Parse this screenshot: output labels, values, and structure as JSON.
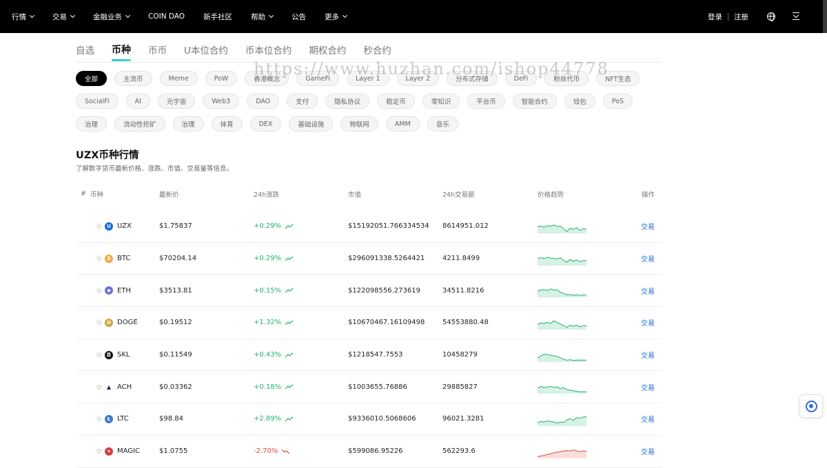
{
  "nav": {
    "items": [
      {
        "label": "行情",
        "dropdown": true
      },
      {
        "label": "交易",
        "dropdown": true
      },
      {
        "label": "金融业务",
        "dropdown": true
      },
      {
        "label": "COIN DAO",
        "dropdown": false
      },
      {
        "label": "新手社区",
        "dropdown": false
      },
      {
        "label": "帮助",
        "dropdown": true
      },
      {
        "label": "公告",
        "dropdown": false
      },
      {
        "label": "更多",
        "dropdown": true
      }
    ],
    "login": "登录",
    "register": "注册",
    "language_icon": "globe-icon",
    "download_icon": "download-icon"
  },
  "tabs": [
    "自选",
    "币种",
    "币币",
    "U本位合约",
    "币本位合约",
    "期权合约",
    "秒合约"
  ],
  "active_tab": 1,
  "chips": [
    [
      "全部",
      "主流币",
      "Meme",
      "PoW",
      "香港概念",
      "GameFi",
      "Layer 1",
      "Layer 2",
      "分布式存储",
      "DeFi",
      "粉丝代币",
      "NFT生态"
    ],
    [
      "SocialFi",
      "AI",
      "元宇宙",
      "Web3",
      "DAO",
      "支付",
      "隐私协议",
      "稳定币",
      "零知识",
      "平台币",
      "智能合约",
      "钱包",
      "PoS"
    ],
    [
      "治理",
      "流动性挖矿",
      "治理",
      "体育",
      "DEX",
      "基础设施",
      "物联网",
      "AMM",
      "音乐"
    ]
  ],
  "watermark": "https://www.huzhan.com/ishop44778",
  "section": {
    "title": "UZX币种行情",
    "subtitle": "了解数字货币最新价格、涨跌、市值、交易量等信息。"
  },
  "table": {
    "headers": {
      "hash": "#",
      "name": "币种",
      "price": "最新价",
      "change": "24h涨跌",
      "cap": "市值",
      "vol": "24h交易额",
      "trend": "价格趋势",
      "op": "操作"
    },
    "rows": [
      {
        "symbol": "UZX",
        "price": "$1.75837",
        "change": "+0.29%",
        "dir": "up",
        "cap": "$15192051.766334534",
        "vol": "8614951.012",
        "icon_color": "#1b6fd6",
        "icon_glyph": "U",
        "spark": [
          0.55,
          0.6,
          0.5,
          0.62,
          0.58,
          0.7,
          0.55,
          0.6,
          0.35,
          0.1,
          0.4,
          0.3,
          0.45,
          0.2,
          0.35,
          0.3
        ],
        "op": "交易"
      },
      {
        "symbol": "BTC",
        "price": "$70204.14",
        "change": "+0.29%",
        "dir": "up",
        "cap": "$296091338.5264421",
        "vol": "4211.8499",
        "icon_color": "#f2a43a",
        "icon_glyph": "₿",
        "spark": [
          0.6,
          0.65,
          0.58,
          0.7,
          0.62,
          0.6,
          0.55,
          0.66,
          0.4,
          0.25,
          0.5,
          0.35,
          0.45,
          0.3,
          0.4,
          0.38
        ],
        "op": "交易"
      },
      {
        "symbol": "ETH",
        "price": "$3513.81",
        "change": "+0.15%",
        "dir": "up",
        "cap": "$122098556.273619",
        "vol": "34511.8216",
        "icon_color": "#6773d9",
        "icon_glyph": "◆",
        "spark": [
          0.5,
          0.6,
          0.65,
          0.55,
          0.7,
          0.6,
          0.62,
          0.4,
          0.3,
          0.15,
          0.2,
          0.1,
          0.18,
          0.12,
          0.15,
          0.14
        ],
        "op": "交易"
      },
      {
        "symbol": "DOGE",
        "price": "$0.19512",
        "change": "+1.32%",
        "dir": "up",
        "cap": "$10670467.16109498",
        "vol": "54553880.48",
        "icon_color": "#c9a63a",
        "icon_glyph": "D",
        "spark": [
          0.4,
          0.55,
          0.5,
          0.6,
          0.5,
          0.75,
          0.6,
          0.45,
          0.3,
          0.15,
          0.35,
          0.25,
          0.35,
          0.2,
          0.3,
          0.28
        ],
        "op": "交易"
      },
      {
        "symbol": "SKL",
        "price": "$0.11549",
        "change": "+0.43%",
        "dir": "up",
        "cap": "$1218547.7553",
        "vol": "10458279",
        "icon_color": "#111111",
        "icon_glyph": "◘",
        "spark": [
          0.3,
          0.5,
          0.65,
          0.6,
          0.55,
          0.5,
          0.45,
          0.3,
          0.2,
          0.1,
          0.15,
          0.08,
          0.12,
          0.1,
          0.12,
          0.1
        ],
        "op": "交易"
      },
      {
        "symbol": "ACH",
        "price": "$0.03362",
        "change": "+0.18%",
        "dir": "up",
        "cap": "$1003655.76886",
        "vol": "29885827",
        "icon_color": "#ffffff",
        "icon_glyph": "▲",
        "spark": [
          0.45,
          0.6,
          0.5,
          0.55,
          0.6,
          0.5,
          0.55,
          0.4,
          0.5,
          0.3,
          0.25,
          0.2,
          0.15,
          0.1,
          0.12,
          0.1
        ],
        "op": "交易"
      },
      {
        "symbol": "LTC",
        "price": "$98.84",
        "change": "+2.89%",
        "dir": "up",
        "cap": "$9336010.5068606",
        "vol": "96021.3281",
        "icon_color": "#3d79d8",
        "icon_glyph": "Ł",
        "spark": [
          0.25,
          0.35,
          0.3,
          0.4,
          0.35,
          0.3,
          0.2,
          0.3,
          0.25,
          0.5,
          0.6,
          0.45,
          0.7,
          0.65,
          0.75,
          0.8
        ],
        "op": "交易"
      },
      {
        "symbol": "MAGIC",
        "price": "$1.0755",
        "change": "-2.70%",
        "dir": "down",
        "cap": "$599086.95226",
        "vol": "562293.6",
        "icon_color": "#d64040",
        "icon_glyph": "✦",
        "spark": [
          0.1,
          0.15,
          0.2,
          0.3,
          0.35,
          0.45,
          0.5,
          0.55,
          0.6,
          0.65,
          0.6,
          0.7,
          0.62,
          0.55,
          0.6,
          0.58
        ],
        "op": "交易"
      }
    ]
  },
  "colors": {
    "up": "#20b26c",
    "down": "#e2473f",
    "link": "#1f6fd2",
    "accent": "#2cc1c6"
  }
}
